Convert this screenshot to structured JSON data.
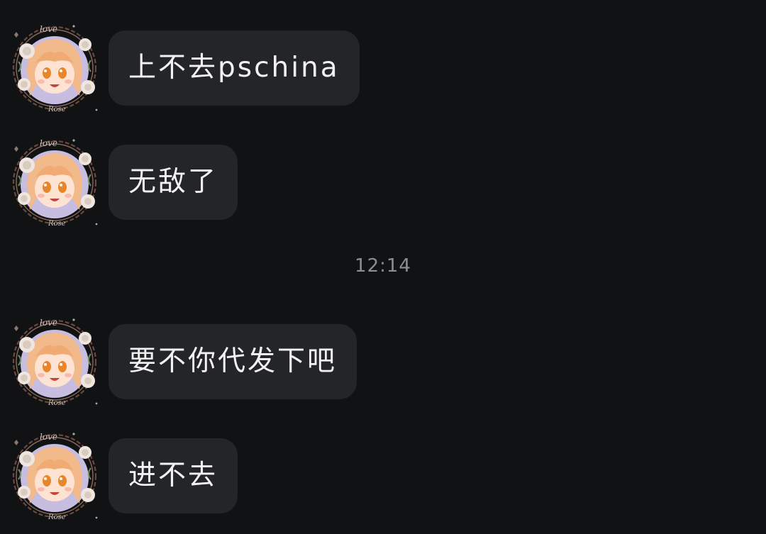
{
  "conversation": {
    "messages": [
      {
        "text": "上不去pschina",
        "sender": "other"
      },
      {
        "text": "无敌了",
        "sender": "other"
      },
      {
        "text": "要不你代发下吧",
        "sender": "other"
      },
      {
        "text": "进不去",
        "sender": "other"
      }
    ],
    "timestamp": "12:14"
  },
  "avatar": {
    "decor_text": "love",
    "decor_text_2": "Rose"
  },
  "colors": {
    "background": "#111214",
    "bubble": "#242528",
    "text": "#f2f2f2",
    "timestamp": "#8d8e92",
    "accent_hair": "#f2b98a"
  }
}
